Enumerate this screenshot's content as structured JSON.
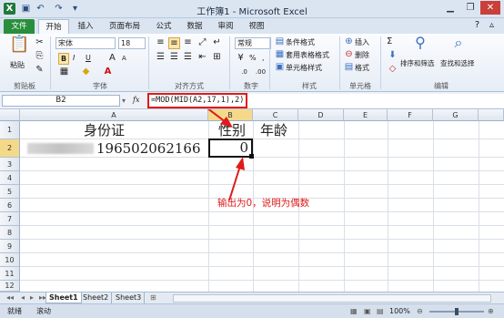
{
  "window": {
    "title": "工作簿1 - Microsoft Excel"
  },
  "quick_access": [
    "excel-logo-icon",
    "save-icon",
    "undo-icon",
    "redo-icon",
    "customize-icon"
  ],
  "tabs": [
    {
      "label": "文件"
    },
    {
      "label": "开始"
    },
    {
      "label": "插入"
    },
    {
      "label": "页面布局"
    },
    {
      "label": "公式"
    },
    {
      "label": "数据"
    },
    {
      "label": "审阅"
    },
    {
      "label": "视图"
    }
  ],
  "ribbon": {
    "clipboard": {
      "paste": "粘贴",
      "group": "剪贴板"
    },
    "font": {
      "name": "宋体",
      "size": "18",
      "bold": "B",
      "italic": "I",
      "underline": "U",
      "grow": "A",
      "shrink": "A",
      "group": "字体"
    },
    "alignment": {
      "group": "对齐方式"
    },
    "number": {
      "format": "常规",
      "percent": "%",
      "comma": ",",
      "group": "数字"
    },
    "styles": {
      "conditional": "条件格式",
      "table": "套用表格格式",
      "cell": "单元格样式",
      "group": "样式"
    },
    "cells": {
      "insert": "插入",
      "delete": "删除",
      "format": "格式",
      "group": "单元格"
    },
    "editing": {
      "sum": "Σ",
      "sort": "排序和筛选",
      "find": "查找和选择",
      "group": "编辑"
    }
  },
  "formula_bar": {
    "name_box": "B2",
    "fx": "fx",
    "formula": "=MOD(MID(A2,17,1),2)"
  },
  "columns": [
    "A",
    "B",
    "C",
    "D",
    "E",
    "F",
    "G"
  ],
  "rows": [
    "1",
    "2",
    "3",
    "4",
    "5",
    "6",
    "7",
    "8",
    "9",
    "10",
    "11",
    "12"
  ],
  "cells": {
    "A1": "身份证",
    "A2": "196502062166",
    "B1": "性别",
    "C1": "年龄",
    "B2": "0"
  },
  "annotation": {
    "text": "输出为0，说明为偶数",
    "color": "#e01a1a"
  },
  "sheets": [
    "Sheet1",
    "Sheet2",
    "Sheet3"
  ],
  "status": {
    "ready": "就绪",
    "scroll": "滚动",
    "zoom": "100%"
  }
}
